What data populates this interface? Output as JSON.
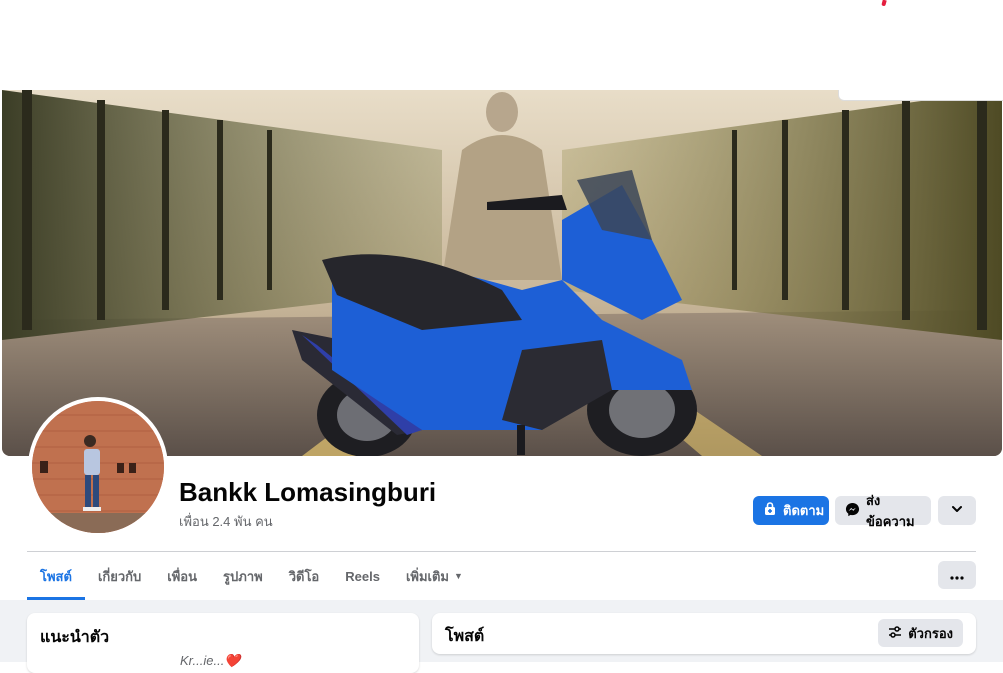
{
  "profile": {
    "name": "Bankk Lomasingburi",
    "friends_text": "เพื่อน 2.4 พัน คน"
  },
  "actions": {
    "follow_label": "ติดตาม",
    "message_label": "ส่งข้อความ"
  },
  "tabs": [
    {
      "label": "โพสต์",
      "active": true
    },
    {
      "label": "เกี่ยวกับ"
    },
    {
      "label": "เพื่อน"
    },
    {
      "label": "รูปภาพ"
    },
    {
      "label": "วิดีโอ"
    },
    {
      "label": "Reels"
    },
    {
      "label": "เพิ่มเติม"
    }
  ],
  "intro": {
    "title": "แนะนำตัว",
    "bio": "Kr...ie...❤️"
  },
  "posts": {
    "title": "โพสต์",
    "filter_label": "ตัวกรอง"
  },
  "colors": {
    "accent": "#1b74e4",
    "scooter": "#1d5fd6"
  },
  "icons": [
    "lock-plus-icon",
    "messenger-icon",
    "chevron-down-icon",
    "caret-down-icon",
    "more-dots-icon",
    "filter-sliders-icon"
  ]
}
